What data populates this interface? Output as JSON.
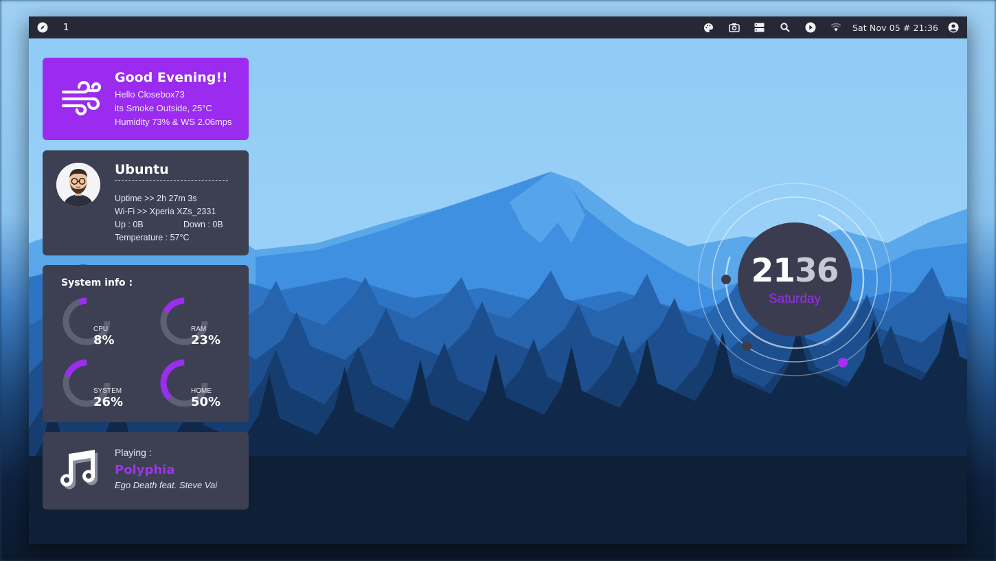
{
  "topbar": {
    "workspace": "1",
    "clock": "Sat Nov 05 # 21:36",
    "icons": [
      "compass-icon",
      "palette-icon",
      "camera-icon",
      "server-icon",
      "search-icon",
      "play-icon",
      "wifi-icon",
      "user-icon"
    ]
  },
  "weather": {
    "title": "Good Evening!!",
    "line1": "Hello Closebox73",
    "line2": "its Smoke Outside, 25°C",
    "line3": "Humidity 73% & WS 2.06mps",
    "icon": "wind-icon"
  },
  "profile": {
    "title": "Ubuntu",
    "uptime": "Uptime >> 2h 27m 3s",
    "wifi": "Wi-Fi >> Xperia XZs_2331",
    "up": "Up : 0B",
    "down": "Down : 0B",
    "temperature": "Temperature : 57°C"
  },
  "system": {
    "title": "System info :",
    "gauges": [
      {
        "label": "CPU",
        "value": "8%",
        "percent": 8
      },
      {
        "label": "RAM",
        "value": "23%",
        "percent": 23
      },
      {
        "label": "SYSTEM",
        "value": "26%",
        "percent": 26
      },
      {
        "label": "HOME",
        "value": "50%",
        "percent": 50
      }
    ]
  },
  "music": {
    "playing_label": "Playing :",
    "artist": "Polyphia",
    "track": "Ego Death feat. Steve Vai",
    "icon": "music-note-icon"
  },
  "clock_widget": {
    "hour": "21",
    "minute": "36",
    "day": "Saturday"
  },
  "colors": {
    "accent": "#9b2def",
    "card": "#3d3f53",
    "topbar": "#262935"
  }
}
